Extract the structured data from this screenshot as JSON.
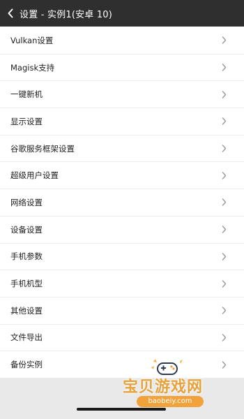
{
  "header": {
    "title": "设置 - 实例1(安卓 10)",
    "back_icon": "chevron-left-icon"
  },
  "settings": {
    "items": [
      {
        "label": "Vulkan设置"
      },
      {
        "label": "Magisk支持"
      },
      {
        "label": "一键新机"
      },
      {
        "label": "显示设置"
      },
      {
        "label": "谷歌服务框架设置"
      },
      {
        "label": "超级用户设置"
      },
      {
        "label": "网络设置"
      },
      {
        "label": "设备设置"
      },
      {
        "label": "手机参数"
      },
      {
        "label": "手机机型"
      },
      {
        "label": "其他设置"
      },
      {
        "label": "文件导出"
      },
      {
        "label": "备份实例"
      }
    ]
  },
  "watermark": {
    "text": "宝贝游戏网",
    "url": "baobeiy.com"
  },
  "colors": {
    "header_bg": "#2f2f2f",
    "row_text": "#222222",
    "chevron": "#9a9a9a",
    "watermark": "#e6a23c"
  }
}
